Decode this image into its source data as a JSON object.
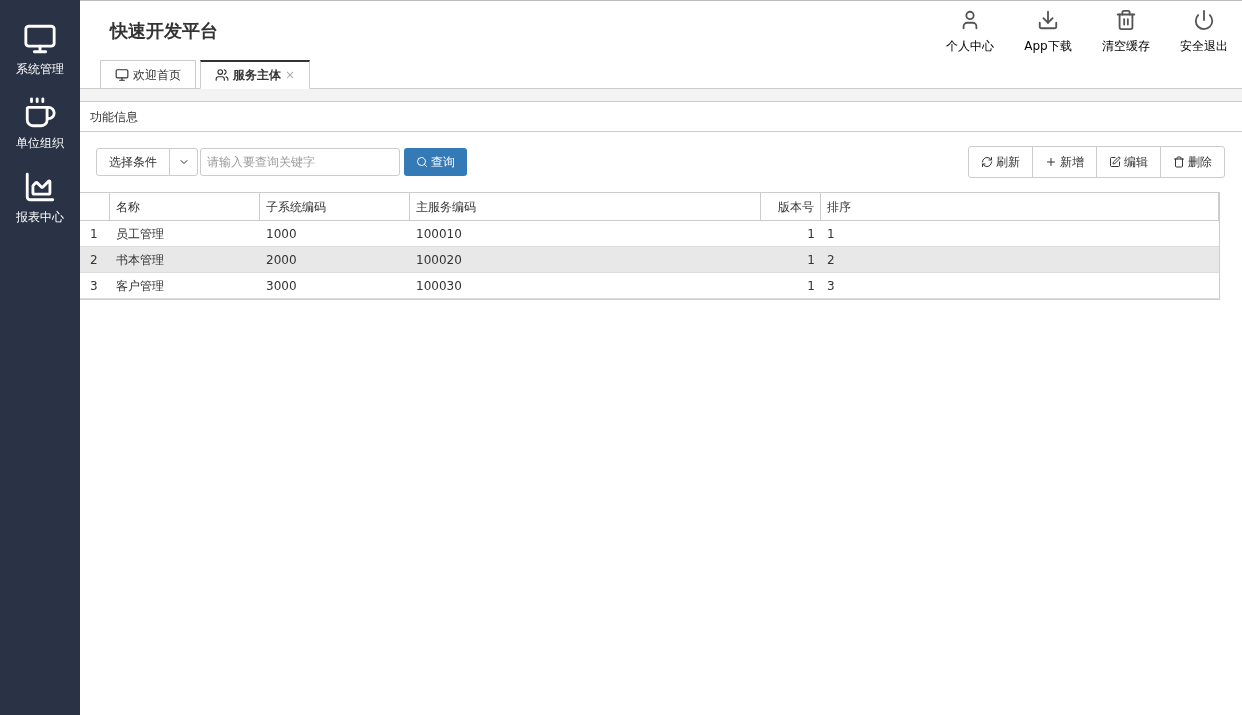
{
  "sidebar": {
    "items": [
      {
        "label": "系统管理"
      },
      {
        "label": "单位组织"
      },
      {
        "label": "报表中心"
      }
    ]
  },
  "header": {
    "title": "快速开发平台",
    "actions": [
      {
        "label": "个人中心"
      },
      {
        "label": "App下载"
      },
      {
        "label": "清空缓存"
      },
      {
        "label": "安全退出"
      }
    ]
  },
  "tabs": [
    {
      "label": "欢迎首页",
      "selected": false
    },
    {
      "label": "服务主体",
      "selected": true,
      "close": "×"
    }
  ],
  "panel": {
    "title": "功能信息"
  },
  "search": {
    "condition": "选择条件",
    "placeholder": "请输入要查询关键字",
    "button": "查询"
  },
  "toolbar": [
    "刷新",
    "新增",
    "编辑",
    "删除"
  ],
  "table": {
    "columns": [
      "名称",
      "子系统编码",
      "主服务编码",
      "版本号",
      "排序"
    ],
    "rows": [
      {
        "index": "1",
        "cells": [
          "员工管理",
          "1000",
          "100010",
          "1",
          "1"
        ],
        "selected": false
      },
      {
        "index": "2",
        "cells": [
          "书本管理",
          "2000",
          "100020",
          "1",
          "2"
        ],
        "selected": true
      },
      {
        "index": "3",
        "cells": [
          "客户管理",
          "3000",
          "100030",
          "1",
          "3"
        ],
        "selected": false
      }
    ]
  }
}
